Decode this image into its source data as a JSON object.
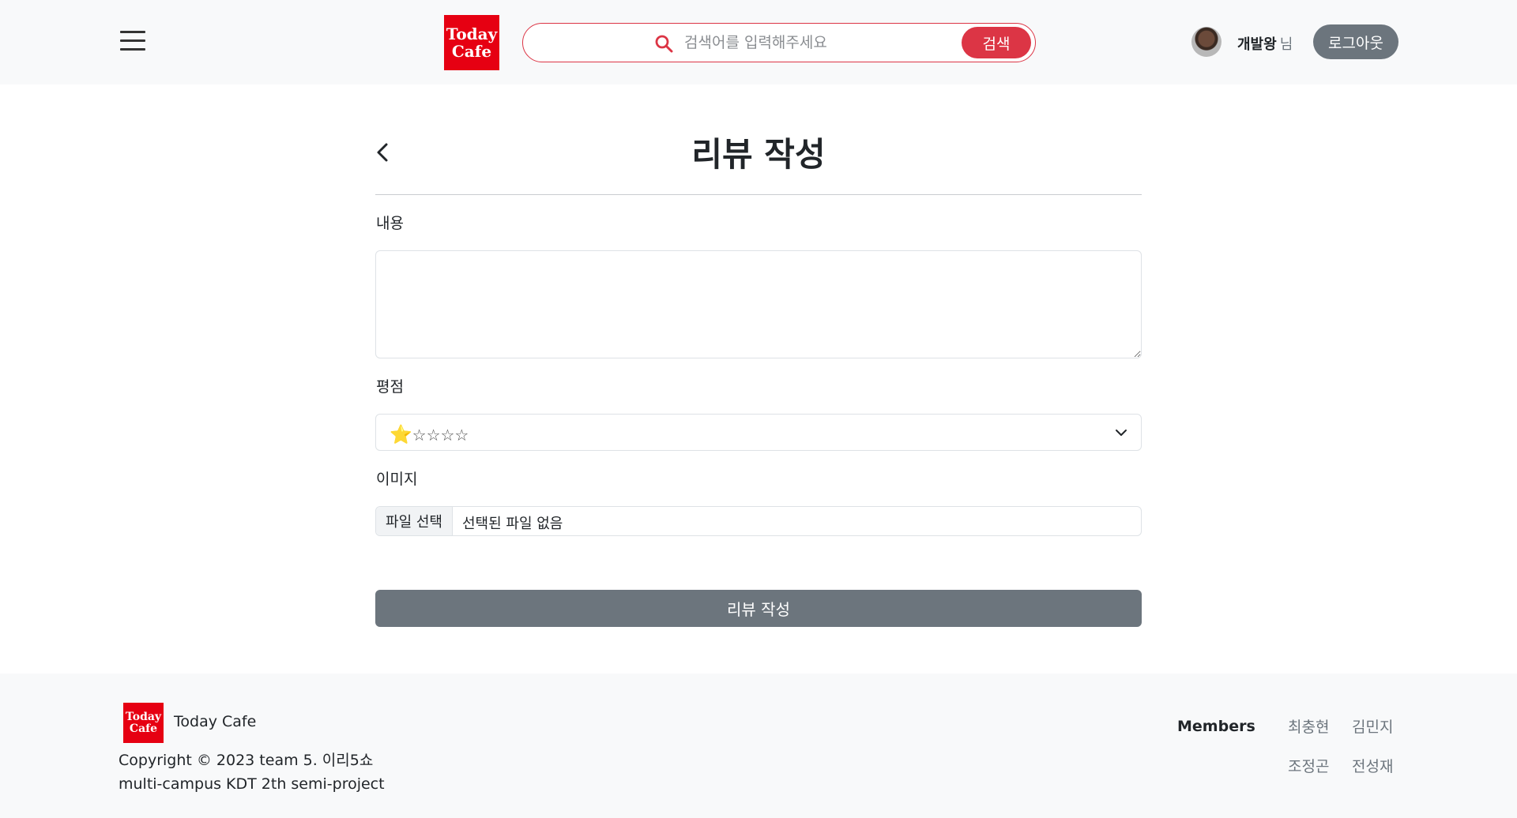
{
  "header": {
    "logo_line1": "Today",
    "logo_line2": "Cafe",
    "search_placeholder": "검색어를 입력해주세요",
    "search_button": "검색",
    "username": "개발왕",
    "username_suffix": "님",
    "logout_button": "로그아웃",
    "menu_icon": "hamburger-icon",
    "search_icon": "search-icon",
    "accent_color": "#dc3545"
  },
  "main": {
    "title": "리뷰 작성",
    "back_icon": "chevron-left-icon",
    "content_label": "내용",
    "content_value": "",
    "rating_label": "평점",
    "rating_selected_star": "⭐",
    "rating_empty_stars": "☆☆☆☆",
    "rating_value": 1,
    "image_label": "이미지",
    "file_button": "파일 선택",
    "file_status": "선택된 파일 없음",
    "submit_button": "리뷰 작성"
  },
  "footer": {
    "logo_line1": "Today",
    "logo_line2": "Cafe",
    "brand": "Today Cafe",
    "copyright": "Copyright © 2023 team 5. 이리5쇼",
    "project": "multi-campus KDT 2th semi-project",
    "members_label": "Members",
    "members": [
      "최충현",
      "김민지",
      "조정곤",
      "전성재"
    ]
  }
}
